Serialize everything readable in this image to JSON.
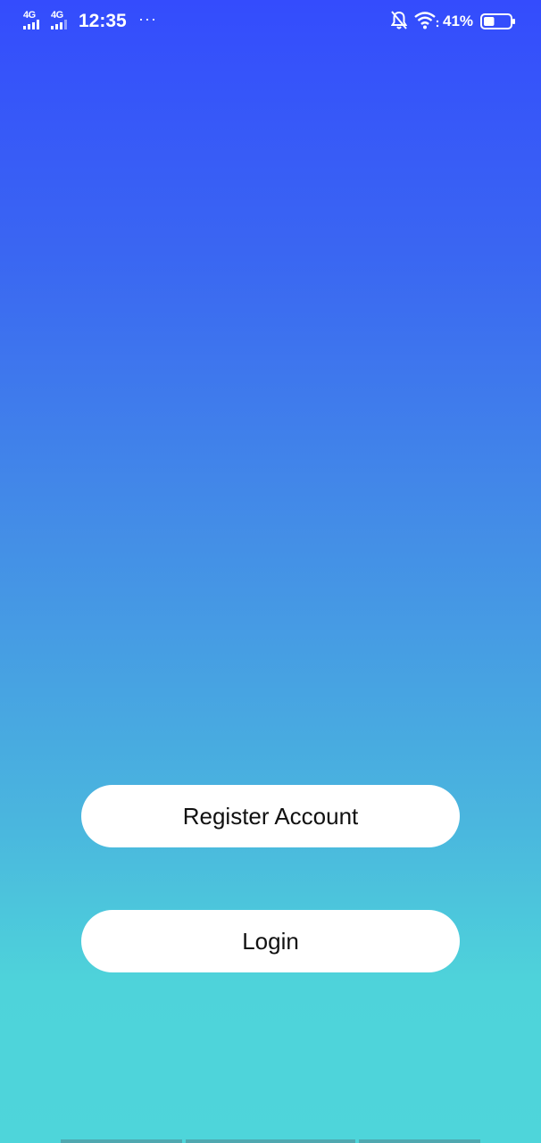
{
  "status_bar": {
    "network_1": "4G",
    "network_2": "4G",
    "time": "12:35",
    "more": "···",
    "battery_percent": "41%",
    "battery_level": 0.41,
    "icons": [
      "signal-icon",
      "signal-icon",
      "notification-off-icon",
      "wifi-icon",
      "battery-icon"
    ]
  },
  "actions": {
    "register_label": "Register Account",
    "login_label": "Login"
  },
  "colors": {
    "gradient_top": "#344cfd",
    "gradient_bottom": "#4ed5da",
    "button_background": "#ffffff",
    "button_text": "#111111"
  }
}
